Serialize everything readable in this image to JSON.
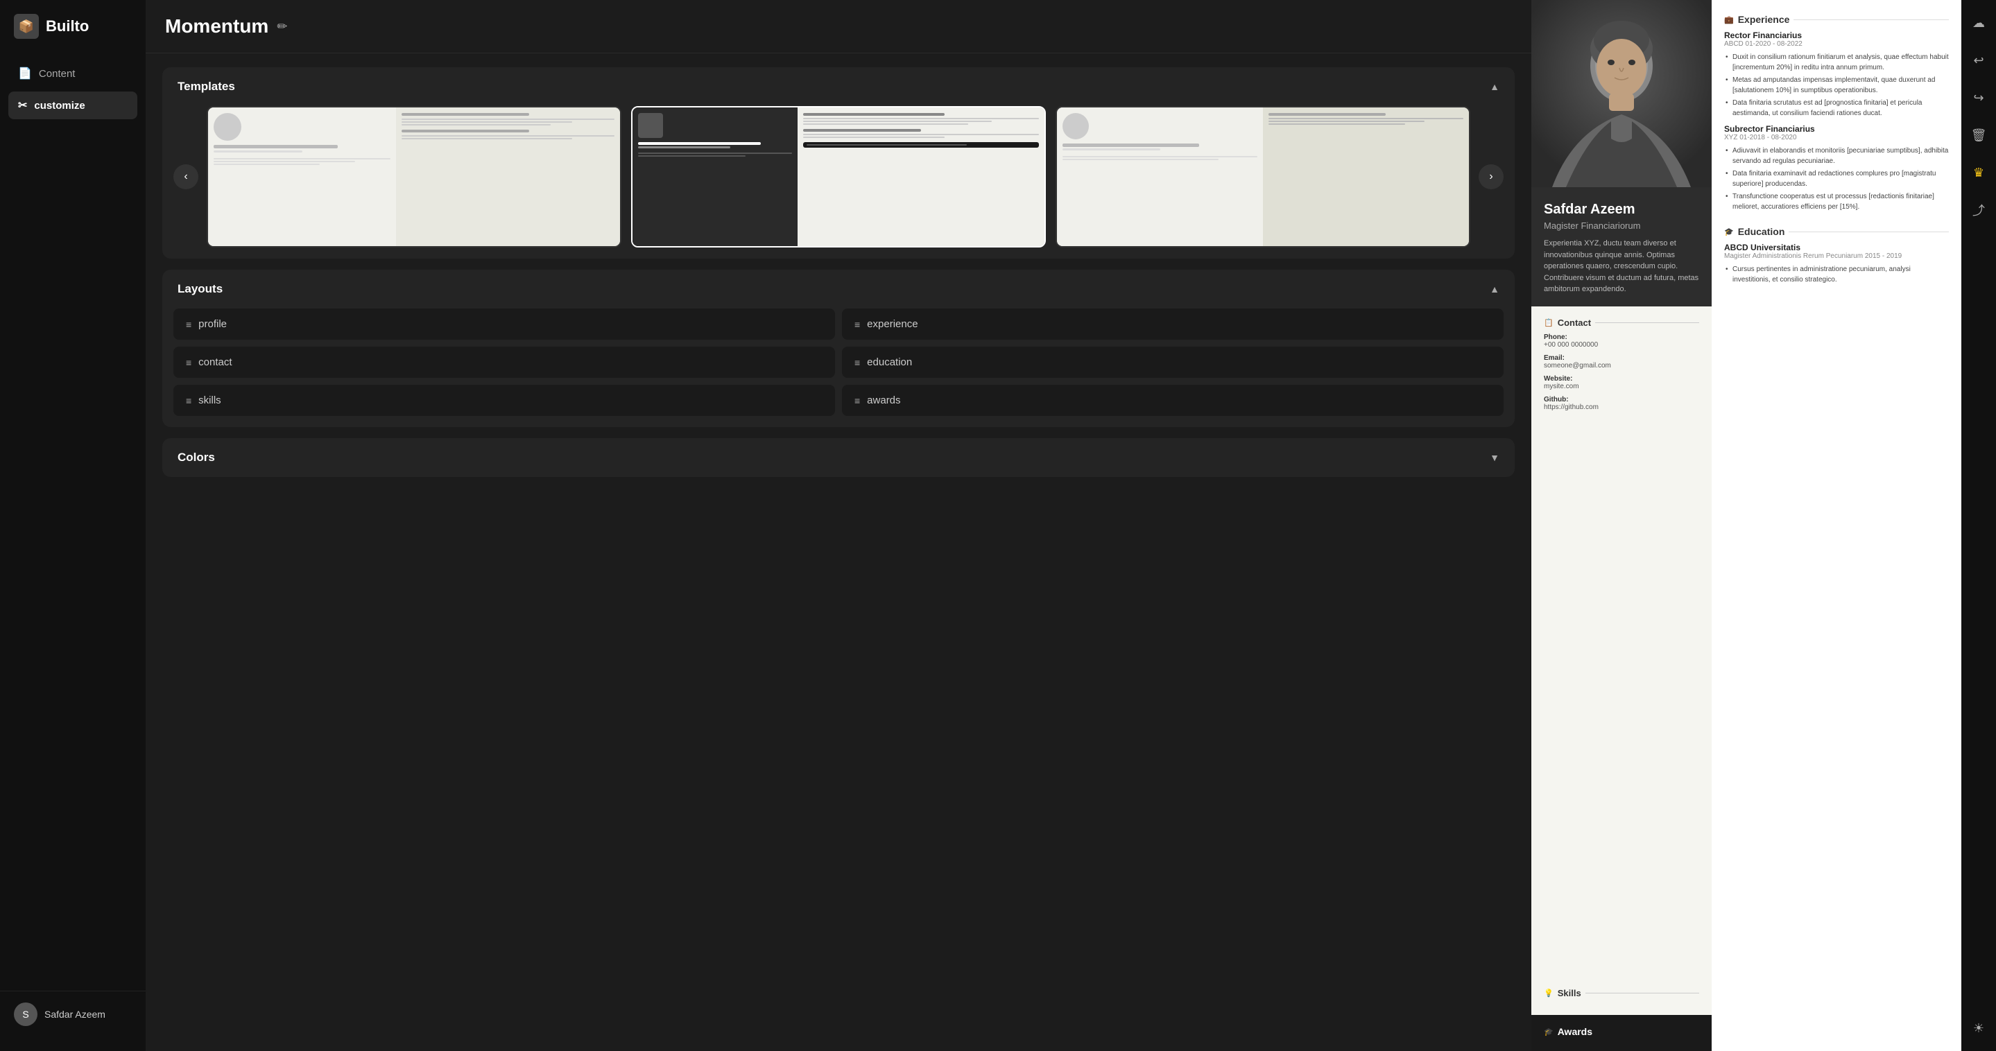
{
  "app": {
    "logo_icon": "📦",
    "logo_text": "Builto"
  },
  "sidebar": {
    "items": [
      {
        "id": "content",
        "label": "Content",
        "icon": "📄",
        "active": false
      },
      {
        "id": "customize",
        "label": "customize",
        "icon": "✂",
        "active": true
      }
    ],
    "user": {
      "name": "Safdar Azeem",
      "avatar_initial": "S"
    }
  },
  "header": {
    "title": "Momentum",
    "edit_icon": "✏"
  },
  "templates": {
    "section_label": "Templates",
    "chevron": "▲",
    "prev_label": "‹",
    "next_label": "›",
    "items": [
      {
        "id": "tmpl1",
        "type": "light",
        "selected": false
      },
      {
        "id": "tmpl2",
        "type": "dark",
        "selected": true
      },
      {
        "id": "tmpl3",
        "type": "light2",
        "selected": false
      }
    ]
  },
  "layouts": {
    "section_label": "Layouts",
    "chevron": "▲",
    "items": [
      {
        "id": "profile",
        "label": "profile"
      },
      {
        "id": "experience",
        "label": "experience"
      },
      {
        "id": "contact",
        "label": "contact"
      },
      {
        "id": "education",
        "label": "education"
      },
      {
        "id": "skills",
        "label": "skills"
      },
      {
        "id": "awards",
        "label": "awards"
      }
    ]
  },
  "colors": {
    "section_label": "Colors",
    "chevron": "▼"
  },
  "resume": {
    "name": "Safdar Azeem",
    "title": "Magister Financiariorum",
    "bio": "Experientia XYZ, ductu team diverso et innovationibus quinque annis. Optimas operationes quaero, crescendum cupio. Contribuere visum et ductum ad futura, metas ambitorum expandendo.",
    "contact": {
      "section_title": "Contact",
      "phone_label": "Phone:",
      "phone_value": "+00 000 0000000",
      "email_label": "Email:",
      "email_value": "someone@gmail.com",
      "website_label": "Website:",
      "website_value": "mysite.com",
      "github_label": "Github:",
      "github_value": "https://github.com"
    },
    "skills": {
      "section_title": "Skills"
    },
    "experience": {
      "section_title": "Experience",
      "jobs": [
        {
          "title": "Rector Financiarius",
          "sub": "ABCD 01-2020 - 08-2022",
          "bullets": [
            "Duxit in consilium rationum finitiarum et analysis, quae effectum habuit [incrementum 20%] in reditu intra annum primum.",
            "Metas ad amputandas impensas implementavit, quae duxerunt ad [salutationem 10%] in sumptibus operationibus.",
            "Data finitaria scrutatus est ad [prognostica finitaria] et pericula aestimanda, ut consilium faciendi rationes ducat."
          ]
        },
        {
          "title": "Subrector Financiarius",
          "sub": "XYZ 01-2018 - 08-2020",
          "bullets": [
            "Adiuvavit in elaborandis et monitoriis [pecuniariae sumptibus], adhibita servando ad regulas pecuniariae.",
            "Data finitaria examinavit ad redactiones complures pro [magistratu superiore] producendas.",
            "Transfunctione cooperatus est ut processus [redactionis finitariae] melioret, accuratiores efficiens per [15%]."
          ]
        }
      ]
    },
    "education": {
      "section_title": "Education",
      "entries": [
        {
          "school": "ABCD Universitatis",
          "degree": "Magister Administrationis Rerum Pecuniarum  2015 - 2019",
          "bullets": [
            "Cursus pertinentes in administratione pecuniarum, analysi investitionis, et consilio strategico."
          ]
        }
      ]
    },
    "awards": {
      "section_title": "Awards"
    }
  },
  "right_icons": [
    {
      "id": "cloud",
      "icon": "☁",
      "label": "cloud-icon"
    },
    {
      "id": "undo",
      "icon": "↩",
      "label": "undo-icon"
    },
    {
      "id": "redo",
      "icon": "↪",
      "label": "redo-icon"
    },
    {
      "id": "trash",
      "icon": "🗑",
      "label": "trash-icon"
    },
    {
      "id": "crown",
      "icon": "♛",
      "label": "crown-icon",
      "class": "crown"
    },
    {
      "id": "share",
      "icon": "⤴",
      "label": "share-icon"
    }
  ],
  "bottom_right_icon": "☀"
}
